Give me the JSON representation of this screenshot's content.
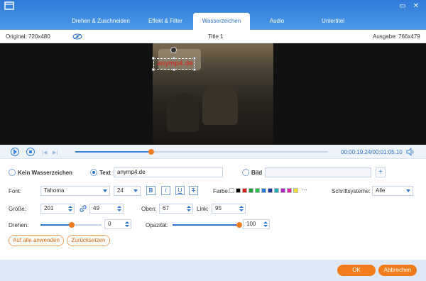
{
  "window": {
    "tabs": [
      {
        "label": "Drehen & Zuschneiden"
      },
      {
        "label": "Effekt & Filter"
      },
      {
        "label": "Wasserzeichen"
      },
      {
        "label": "Audio"
      },
      {
        "label": "Untertitel"
      }
    ],
    "active_tab": "Wasserzeichen",
    "minimize_icon": "minimize-icon",
    "close_icon": "close-icon"
  },
  "infobar": {
    "original": "Original: 720x480",
    "title": "Title 1",
    "output": "Ausgabe: 766x479"
  },
  "preview": {
    "watermark_text": "anymp4.de",
    "watermark_color": "#e01818"
  },
  "playback": {
    "progress": 0.3,
    "timecode": "00:00:19.24/00:01:05.10"
  },
  "watermark": {
    "none_label": "Kein Wasserzeichen",
    "text_label": "Text",
    "text_value": "anymp4.de",
    "image_label": "Bild",
    "font_label": "Font:",
    "font_value": "Tahoma",
    "font_size": "24",
    "bold": "B",
    "italic": "I",
    "underline": "U",
    "strike": "T",
    "color_label": "Farbe:",
    "colors": [
      "#ffffff",
      "#000000",
      "#e01818",
      "#1f9d3a",
      "#26c24b",
      "#2a7bd6",
      "#1a3aa0",
      "#1ab0b0",
      "#b020c0",
      "#e020a0",
      "#f0e030"
    ],
    "more_colors": "···",
    "script_label": "Schriftsysteme:",
    "script_value": "Alle",
    "size_label": "Größe:",
    "width": "201",
    "height": "49",
    "top_label": "Oben:",
    "top_value": "67",
    "left_label": "Link:",
    "left_value": "95",
    "rotate_label": "Drehen:",
    "rotate_value": "0",
    "opacity_label": "Opazität:",
    "opacity_value": "100",
    "apply_all": "Auf alle anwenden",
    "reset": "Zurücksetzen"
  },
  "footer": {
    "ok": "OK",
    "cancel": "Abbrechen"
  }
}
